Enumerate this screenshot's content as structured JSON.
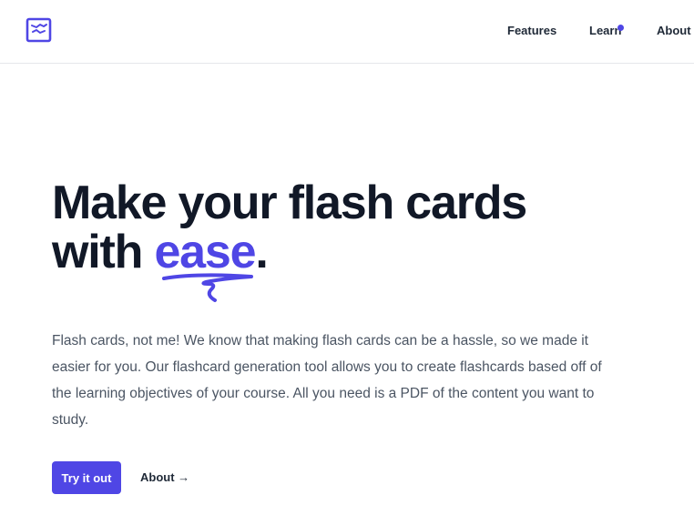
{
  "nav": {
    "logo_icon": "flashcard-logo-icon",
    "items": [
      {
        "label": "Features"
      },
      {
        "label": "Learn",
        "has_indicator": true
      },
      {
        "label": "About"
      }
    ]
  },
  "hero": {
    "headline_line1": "Make your flash cards",
    "headline_line2_prefix": "with ",
    "headline_accent": "ease",
    "headline_suffix": ".",
    "description": "Flash cards, not me! We know that making flash cards can be a hassle, so we made it easier for you. Our flashcard generation tool allows you to create flashcards based off of the learning objectives of your course. All you need is a PDF of the content you want to study.",
    "primary_button": "Try it out",
    "secondary_link": "About →"
  },
  "colors": {
    "accent": "#4f46e5",
    "text": "#111827",
    "muted": "#4b5563"
  }
}
